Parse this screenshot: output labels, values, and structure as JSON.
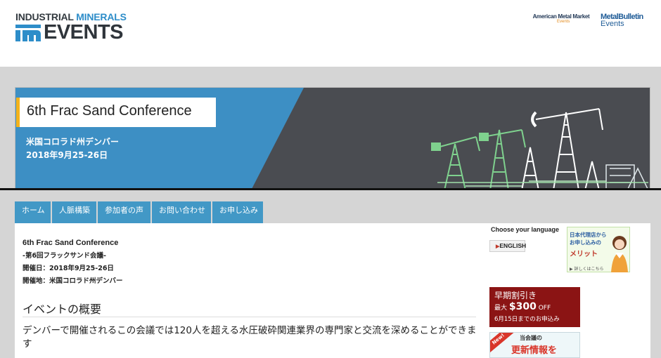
{
  "header": {
    "logo": {
      "line1_part1": "INDUSTRIAL ",
      "line1_part2": "MINERALS",
      "line2": "EVENTS"
    },
    "partners": {
      "amm": {
        "name": "American Metal Market",
        "sub": "Events"
      },
      "mb": {
        "name": "MetalBulletin",
        "sub": "Events"
      }
    }
  },
  "banner": {
    "title": "6th Frac Sand Conference",
    "location": "米国コロラド州デンバー",
    "date": "2018年9月25-26日"
  },
  "nav": {
    "items": [
      "ホーム",
      "人脈構築",
      "参加者の声",
      "お問い合わせ",
      "お申し込み"
    ]
  },
  "main": {
    "event_name": "6th Frac Sand Conference",
    "subtitle": "-第6回フラックサンド会議-",
    "dates": "開催日：2018年9月25-26日",
    "venue": "開催地：米国コロラド州デンバー",
    "overview_heading": "イベントの概要",
    "overview_text": "デンバーで開催されるこの会議では120人を超える水圧破砕関連業界の専門家と交流を深めることができます"
  },
  "sidebar": {
    "choose_language": "Choose your language",
    "english_button": "ENGLISH",
    "agent_banner": {
      "line1": "日本代理店から",
      "line2": "お申し込みの",
      "line3": "メリット",
      "link": "▶ 詳しくはこちら"
    },
    "early_bird": {
      "line1": "早期割引き",
      "prefix": "最大 ",
      "amount": "$300",
      "suffix": " OFF",
      "deadline": "6月15日までのお申込み"
    },
    "update_banner": {
      "ribbon": "New!",
      "line1": "当会議の",
      "line2": "更新情報を"
    }
  },
  "colors": {
    "nav_blue": "#4298c6",
    "banner_blue": "#3d8fc4",
    "banner_dark": "#4a4c51",
    "accent_yellow": "#f4b21a",
    "early_bird_red": "#8b1414"
  }
}
